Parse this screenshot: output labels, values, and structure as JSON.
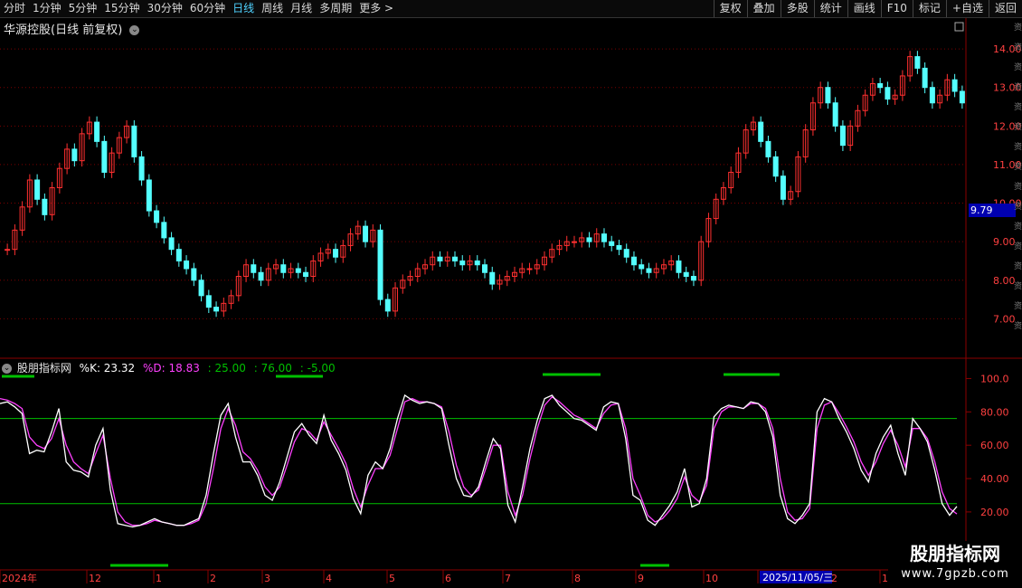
{
  "toolbar": {
    "periods": [
      "分时",
      "1分钟",
      "5分钟",
      "15分钟",
      "30分钟",
      "60分钟",
      "日线",
      "周线",
      "月线",
      "多周期",
      "更多 >"
    ],
    "active": "日线",
    "right_buttons": [
      "复权",
      "叠加",
      "多股",
      "统计",
      "画线",
      "F10",
      "标记",
      "+自选",
      "返回"
    ]
  },
  "stock": {
    "title": "华源控股(日线 前复权)"
  },
  "price_axis": {
    "ticks": [
      "14.00",
      "13.00",
      "12.00",
      "11.00",
      "10.00",
      "9.00",
      "8.00",
      "7.00"
    ],
    "current_price": "9.79"
  },
  "oscillator": {
    "name": "股朋指标网",
    "k_label": "%K: 23.32",
    "d_label": "%D: 18.83",
    "level1": ": 25.00",
    "level2": ": 76.00",
    "level3": ": -5.00",
    "axis_ticks": [
      "100.0",
      "80.00",
      "60.00",
      "40.00",
      "20.00"
    ]
  },
  "time_axis": {
    "labels": [
      "2024年",
      "12",
      "1",
      "2",
      "3",
      "4",
      "5",
      "6",
      "7",
      "8",
      "9",
      "10",
      "11",
      "12",
      "1"
    ],
    "cursor_date": "2025/11/05/三"
  },
  "watermark": {
    "line1": "股朋指标网",
    "line2": "www.7gpzb.com"
  },
  "colors": {
    "up": "#ff3030",
    "down": "#54ffff",
    "k_line": "#ffffff",
    "d_line": "#ff40ff",
    "level": "#00c000",
    "grid": "#7a0000"
  },
  "chart_data": {
    "type": "candlestick",
    "price_range": [
      6.0,
      14.8
    ],
    "closes": [
      8.8,
      9.3,
      9.9,
      10.6,
      10.1,
      9.7,
      10.4,
      10.9,
      11.4,
      11.1,
      11.8,
      12.1,
      11.6,
      10.8,
      11.3,
      11.7,
      12.0,
      11.2,
      10.6,
      9.8,
      9.5,
      9.1,
      8.8,
      8.5,
      8.3,
      8.0,
      7.6,
      7.3,
      7.2,
      7.4,
      7.6,
      8.1,
      8.4,
      8.2,
      8.0,
      8.3,
      8.4,
      8.2,
      8.3,
      8.2,
      8.1,
      8.5,
      8.7,
      8.8,
      8.6,
      8.9,
      9.2,
      9.4,
      9.0,
      9.3,
      7.5,
      7.2,
      7.8,
      8.0,
      8.1,
      8.3,
      8.4,
      8.6,
      8.5,
      8.6,
      8.5,
      8.4,
      8.5,
      8.4,
      8.2,
      7.9,
      8.0,
      8.1,
      8.2,
      8.3,
      8.3,
      8.4,
      8.6,
      8.8,
      8.9,
      9.0,
      9.0,
      9.1,
      9.0,
      9.2,
      9.0,
      8.9,
      8.8,
      8.6,
      8.4,
      8.3,
      8.2,
      8.3,
      8.4,
      8.5,
      8.2,
      8.1,
      8.0,
      9.0,
      9.6,
      10.1,
      10.4,
      10.8,
      11.3,
      11.9,
      12.1,
      11.6,
      11.2,
      10.7,
      10.1,
      10.3,
      11.2,
      11.9,
      12.6,
      13.0,
      12.6,
      12.0,
      11.5,
      12.0,
      12.4,
      12.8,
      13.1,
      13.0,
      12.7,
      12.8,
      13.3,
      13.8,
      13.5,
      13.0,
      12.6,
      12.8,
      13.2,
      12.9,
      12.6
    ],
    "k_series": [
      85,
      86,
      83,
      79,
      55,
      57,
      56,
      68,
      82,
      50,
      45,
      44,
      41,
      60,
      70,
      33,
      13,
      12,
      11,
      12,
      14,
      16,
      14,
      13,
      12,
      12,
      14,
      16,
      30,
      55,
      78,
      85,
      65,
      50,
      50,
      42,
      30,
      27,
      38,
      53,
      68,
      73,
      66,
      61,
      78,
      63,
      55,
      45,
      28,
      19,
      42,
      50,
      46,
      58,
      76,
      90,
      87,
      85,
      86,
      85,
      82,
      60,
      40,
      30,
      29,
      35,
      50,
      64,
      58,
      24,
      14,
      35,
      58,
      75,
      88,
      90,
      84,
      80,
      76,
      75,
      72,
      69,
      83,
      86,
      85,
      64,
      30,
      27,
      15,
      12,
      18,
      24,
      32,
      46,
      23,
      25,
      40,
      77,
      82,
      84,
      83,
      82,
      86,
      85,
      80,
      65,
      30,
      16,
      13,
      18,
      25,
      80,
      88,
      86,
      76,
      68,
      58,
      45,
      38,
      55,
      65,
      72,
      55,
      42,
      76,
      70,
      62,
      45,
      25,
      18,
      23.3
    ],
    "d_series": [
      88,
      87,
      85,
      82,
      65,
      60,
      58,
      64,
      76,
      60,
      50,
      46,
      43,
      55,
      66,
      40,
      20,
      14,
      12,
      12,
      13,
      15,
      14,
      13,
      12,
      12,
      13,
      15,
      25,
      46,
      70,
      82,
      72,
      56,
      52,
      45,
      35,
      30,
      35,
      48,
      62,
      70,
      68,
      63,
      74,
      66,
      58,
      49,
      34,
      23,
      36,
      46,
      46,
      54,
      70,
      86,
      88,
      86,
      86,
      85,
      83,
      68,
      48,
      35,
      30,
      33,
      46,
      60,
      60,
      32,
      18,
      30,
      52,
      70,
      84,
      89,
      86,
      82,
      78,
      76,
      73,
      70,
      79,
      84,
      85,
      70,
      40,
      30,
      18,
      14,
      16,
      21,
      28,
      41,
      30,
      26,
      36,
      70,
      80,
      83,
      83,
      82,
      85,
      85,
      82,
      70,
      40,
      20,
      15,
      16,
      22,
      70,
      84,
      86,
      79,
      71,
      62,
      50,
      42,
      50,
      61,
      69,
      60,
      47,
      70,
      70,
      64,
      50,
      32,
      22,
      18.8
    ]
  }
}
